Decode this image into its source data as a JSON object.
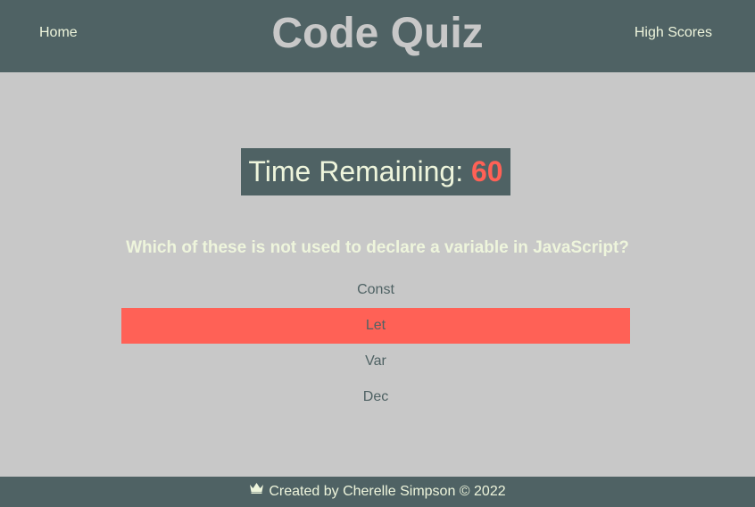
{
  "header": {
    "home_label": "Home",
    "title": "Code Quiz",
    "high_scores_label": "High Scores"
  },
  "timer": {
    "label": "Time Remaining: ",
    "value": "60"
  },
  "quiz": {
    "question": "Which of these is not used to declare a variable in JavaScript?",
    "choices": [
      {
        "label": "Const"
      },
      {
        "label": "Let"
      },
      {
        "label": "Var"
      },
      {
        "label": "Dec"
      }
    ],
    "selected_index": 1
  },
  "footer": {
    "icon": "crown-icon",
    "text": "Created by Cherelle Simpson © 2022"
  },
  "colors": {
    "header_bg": "#4f6264",
    "page_bg": "#c8c8c8",
    "accent": "#ff6156",
    "light_text": "#eef5dc"
  }
}
